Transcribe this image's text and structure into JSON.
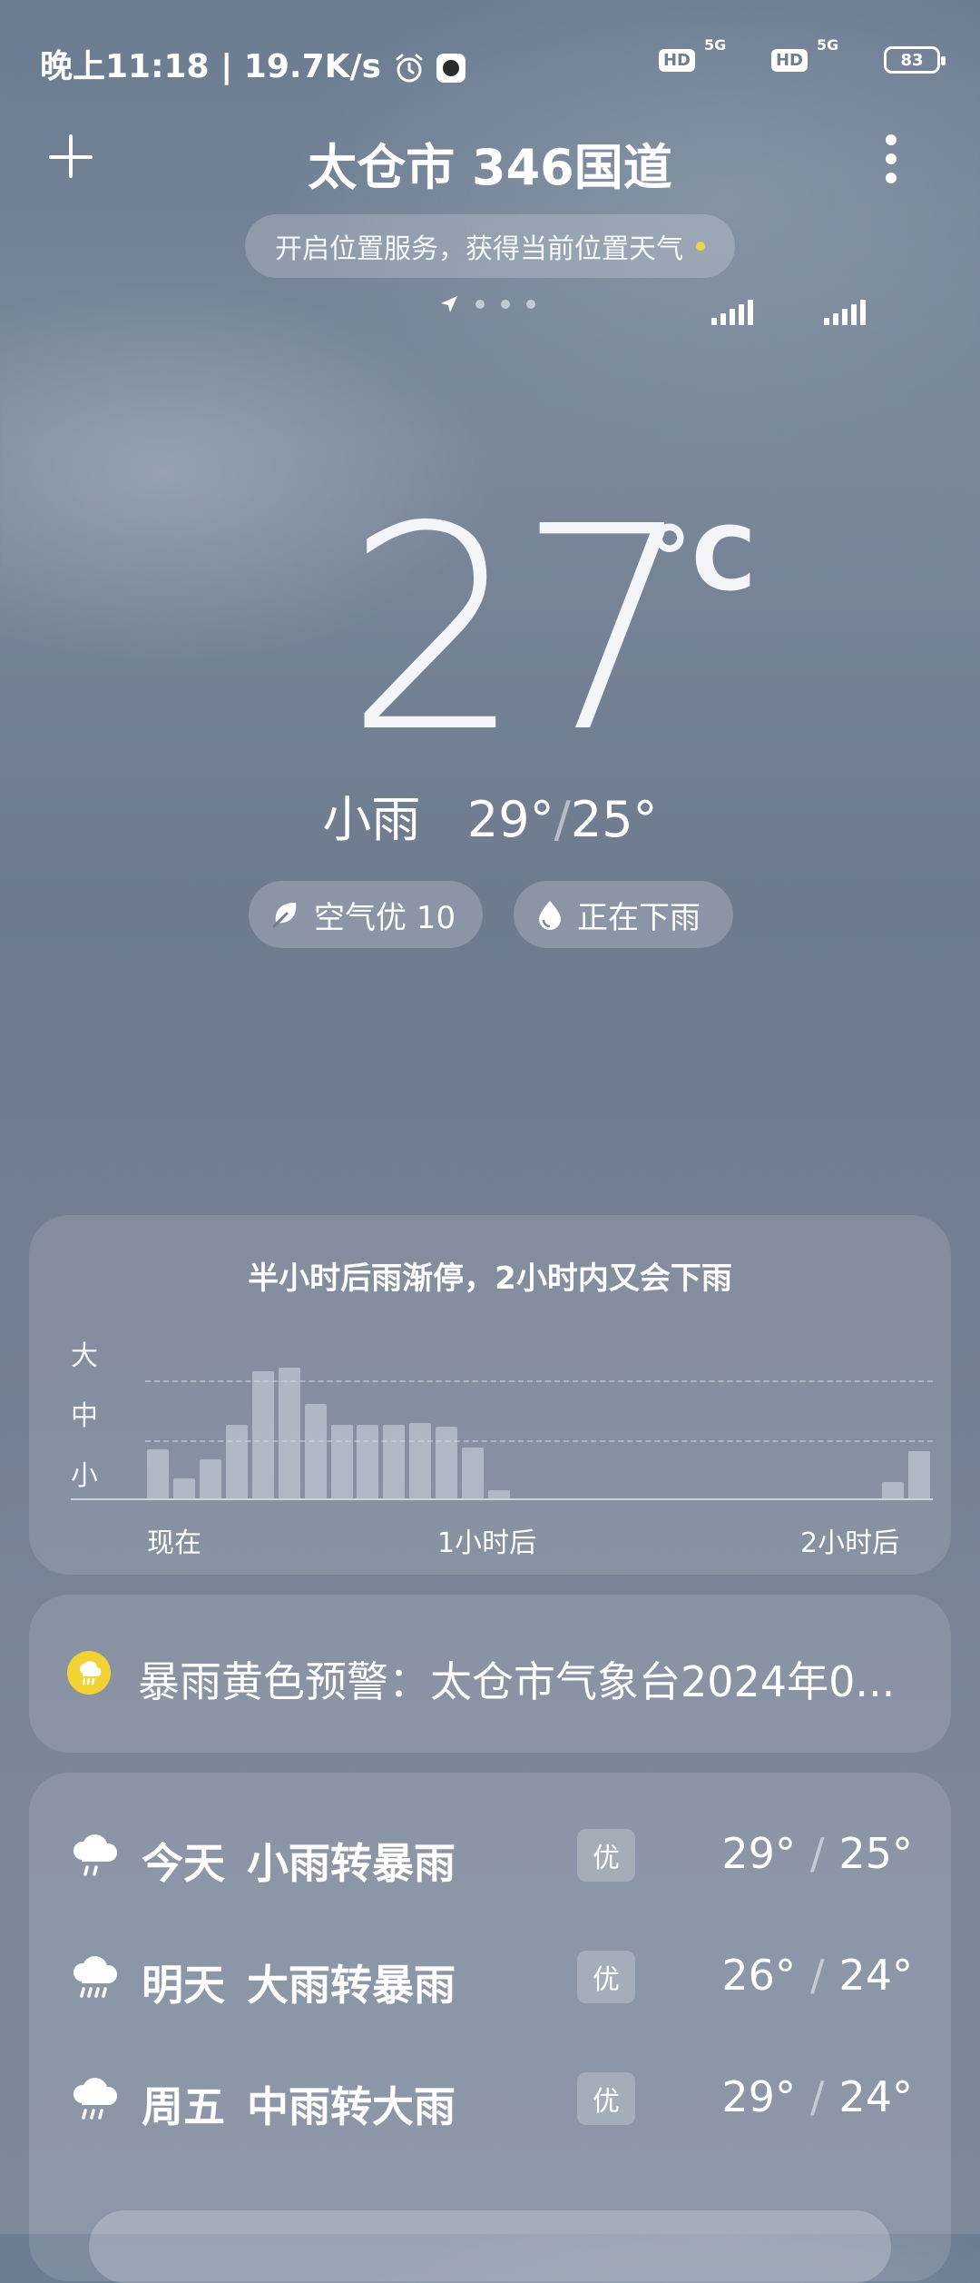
{
  "status_bar": {
    "time_speed": "晚上11:18 | 19.7K/s",
    "battery": "83",
    "network1": "5G",
    "network2": "5G",
    "hd": "HD"
  },
  "header": {
    "location": "太仓市 346国道",
    "location_prompt": "开启位置服务，获得当前位置天气"
  },
  "current": {
    "temperature": "27",
    "unit": "°C",
    "condition": "小雨",
    "high": "29°",
    "low": "25°",
    "air_quality": "空气优 10",
    "rain_status": "正在下雨"
  },
  "rain_forecast": {
    "headline": "半小时后雨渐停，2小时内又会下雨",
    "levels": [
      "大",
      "中",
      "小"
    ],
    "x_labels": [
      "现在",
      "1小时后",
      "2小时后"
    ],
    "intensity": [
      0.3,
      0.12,
      0.24,
      0.45,
      0.78,
      0.8,
      0.58,
      0.45,
      0.45,
      0.45,
      0.46,
      0.44,
      0.31,
      0.05,
      0,
      0,
      0,
      0,
      0,
      0,
      0,
      0,
      0,
      0,
      0,
      0,
      0,
      0,
      0.1,
      0.29
    ]
  },
  "warning": {
    "text": "暴雨黄色预警：太仓市气象台2024年0...",
    "color": "#f3d334"
  },
  "forecast": [
    {
      "day": "今天",
      "condition": "小雨转暴雨",
      "aqi": "优",
      "high": "29°",
      "low": "25°",
      "icon": "rain-cloud-icon"
    },
    {
      "day": "明天",
      "condition": "大雨转暴雨",
      "aqi": "优",
      "high": "26°",
      "low": "24°",
      "icon": "heavy-rain-cloud-icon"
    },
    {
      "day": "周五",
      "condition": "中雨转大雨",
      "aqi": "优",
      "high": "29°",
      "low": "24°",
      "icon": "rain-cloud-icon"
    }
  ],
  "separator": "/"
}
